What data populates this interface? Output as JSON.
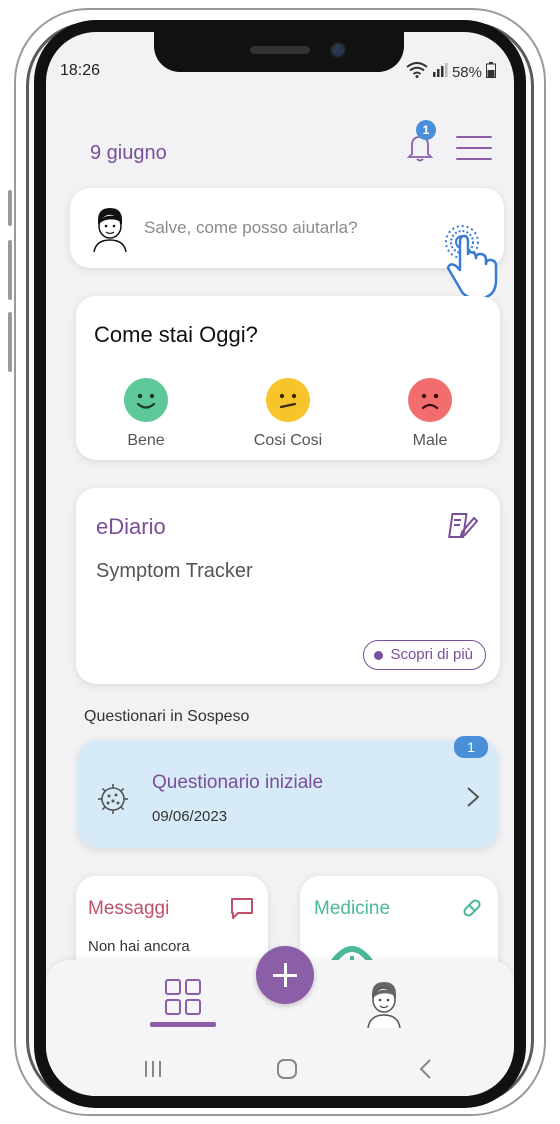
{
  "status_bar": {
    "time": "18:26",
    "battery": "58%"
  },
  "header": {
    "date": "9 giugno",
    "notification_count": "1"
  },
  "assistant": {
    "placeholder": "Salve, come posso aiutarla?"
  },
  "mood": {
    "title": "Come stai Oggi?",
    "options": [
      {
        "label": "Bene",
        "color": "#5dc99a"
      },
      {
        "label": "Cosi Cosi",
        "color": "#f7c42a"
      },
      {
        "label": "Male",
        "color": "#f26d6d"
      }
    ]
  },
  "ediario": {
    "title": "eDiario",
    "subtitle": "Symptom Tracker",
    "button": "Scopri di più"
  },
  "questionari": {
    "section_label": "Questionari in Sospeso",
    "badge": "1",
    "item": {
      "title": "Questionario iniziale",
      "date": "09/06/2023"
    }
  },
  "messaggi": {
    "title": "Messaggi",
    "text": "Non hai ancora"
  },
  "medicine": {
    "title": "Medicine"
  },
  "colors": {
    "accent": "#8b5ea8",
    "badge": "#4a90d9",
    "messages": "#c0506a",
    "medicine": "#4cb89a",
    "quest_bg": "#d6eaf8"
  }
}
